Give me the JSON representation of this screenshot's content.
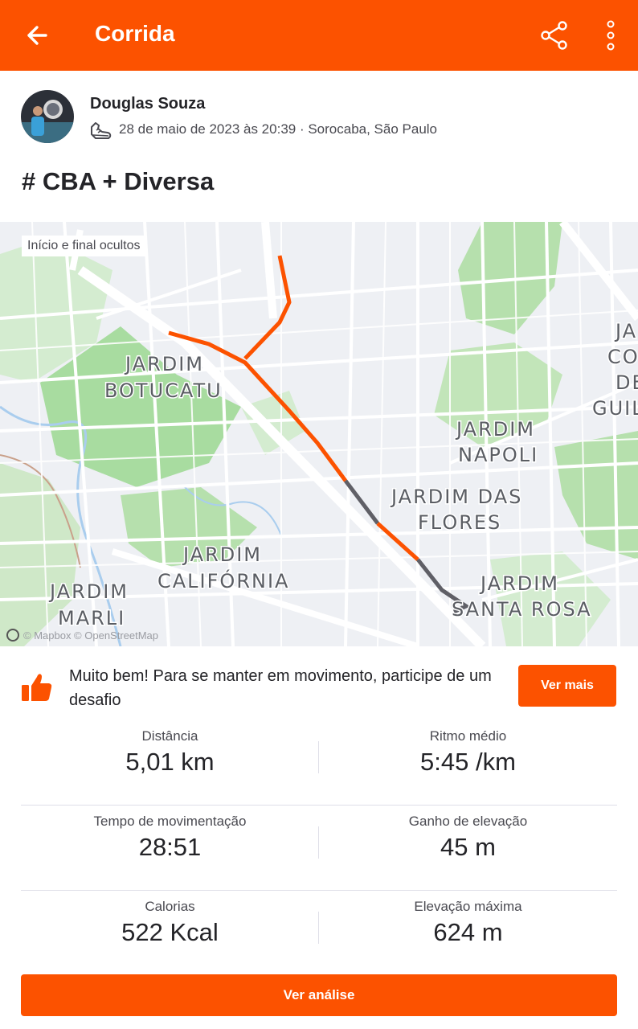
{
  "topbar": {
    "title": "Corrida",
    "back_icon": "arrow-left-icon",
    "share_icon": "share-icon",
    "more_icon": "more-vertical-icon",
    "color": "#fc5200"
  },
  "activity": {
    "athlete_name": "Douglas Souza",
    "activity_type_icon": "running-shoe-icon",
    "date_location": "28 de maio de 2023 às 20:39 · Sorocaba, São Paulo",
    "title": "# CBA + Diversa"
  },
  "map": {
    "privacy_label": "Início e final ocultos",
    "attribution": "© Mapbox © OpenStreetMap",
    "neighborhoods": [
      [
        "JARDIM",
        "BOTUCATU"
      ],
      [
        "JARDIM",
        "NAPOLI"
      ],
      [
        "JARDIM DAS",
        "FLORES"
      ],
      [
        "JARDIM",
        "CALIFÓRNIA"
      ],
      [
        "JARDIM",
        "MARLI"
      ],
      [
        "JARDIM",
        "SANTA ROSA"
      ],
      [
        "JA",
        "CO",
        "DE",
        "GUIL"
      ]
    ],
    "route_color": "#fc5200",
    "hidden_route_color": "#5f5f66"
  },
  "promo": {
    "text": "Muito bem! Para se manter em movimento, participe de um desafio",
    "button_label": "Ver mais",
    "icon": "thumbs-up-icon"
  },
  "stats": [
    {
      "left": {
        "label": "Distância",
        "value": "5,01 km"
      },
      "right": {
        "label": "Ritmo médio",
        "value": "5:45 /km"
      }
    },
    {
      "left": {
        "label": "Tempo de movimentação",
        "value": "28:51"
      },
      "right": {
        "label": "Ganho de elevação",
        "value": "45 m"
      }
    },
    {
      "left": {
        "label": "Calorias",
        "value": "522 Kcal"
      },
      "right": {
        "label": "Elevação máxima",
        "value": "624 m"
      }
    }
  ],
  "analysis_button": "Ver análise"
}
